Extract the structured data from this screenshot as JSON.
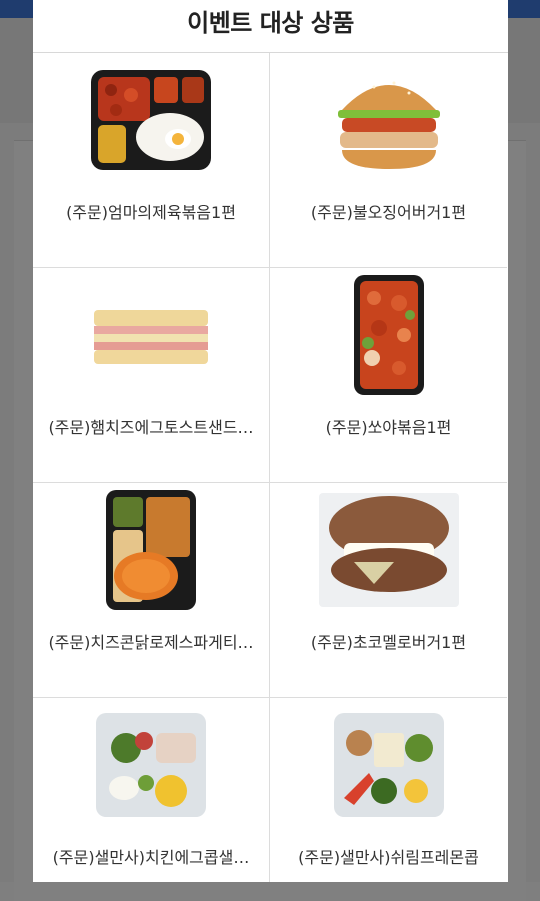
{
  "modal": {
    "title": "이벤트 대상 상품"
  },
  "products": [
    {
      "name": "(주문)엄마의제육볶음1편",
      "icon": "lunchbox-pork-icon"
    },
    {
      "name": "(주문)불오징어버거1편",
      "icon": "burger-icon"
    },
    {
      "name": "(주문)햄치즈에그토스트샌드…",
      "icon": "sandwich-icon"
    },
    {
      "name": "(주문)쏘야볶음1편",
      "icon": "sausage-lunchbox-icon"
    },
    {
      "name": "(주문)치즈콘닭로제스파게티…",
      "icon": "pasta-lunchbox-icon"
    },
    {
      "name": "(주문)초코멜로버거1편",
      "icon": "choco-burger-icon"
    },
    {
      "name": "(주문)샐만사)치킨에그콥샐…",
      "icon": "salad-chicken-icon"
    },
    {
      "name": "(주문)샐만사)쉬림프레몬콥",
      "icon": "salad-shrimp-icon"
    }
  ],
  "colors": {
    "overlay": "#7f7f7f",
    "topbar": "#1f3c6e",
    "modal_bg": "#ffffff",
    "divider": "#dcdcdc"
  }
}
